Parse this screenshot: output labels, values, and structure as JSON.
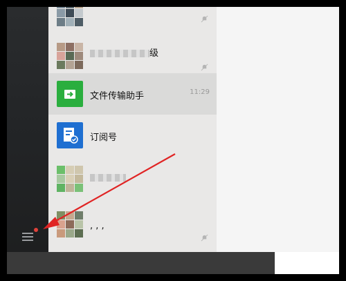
{
  "chats": [
    {
      "id": "group-top",
      "name": "",
      "time": "",
      "muted": true
    },
    {
      "id": "group-2",
      "name": "级",
      "time": "",
      "muted": true
    },
    {
      "id": "file-transfer",
      "name": "文件传输助手",
      "time": "11:29",
      "muted": false,
      "icon": "file-transfer-icon",
      "color": "#2aae3e"
    },
    {
      "id": "subscriptions",
      "name": "订阅号",
      "time": "",
      "muted": false,
      "icon": "subscription-icon",
      "color": "#1f6fd1"
    },
    {
      "id": "blurred-contact",
      "name": "",
      "time": "",
      "muted": false
    },
    {
      "id": "group-3",
      "name": ",  ,  ,",
      "time": "",
      "muted": true
    }
  ],
  "sidebar": {
    "menu_icon": "menu-icon",
    "badge_color": "#e0413a"
  },
  "annotation": {
    "arrow_color": "#e02424"
  }
}
